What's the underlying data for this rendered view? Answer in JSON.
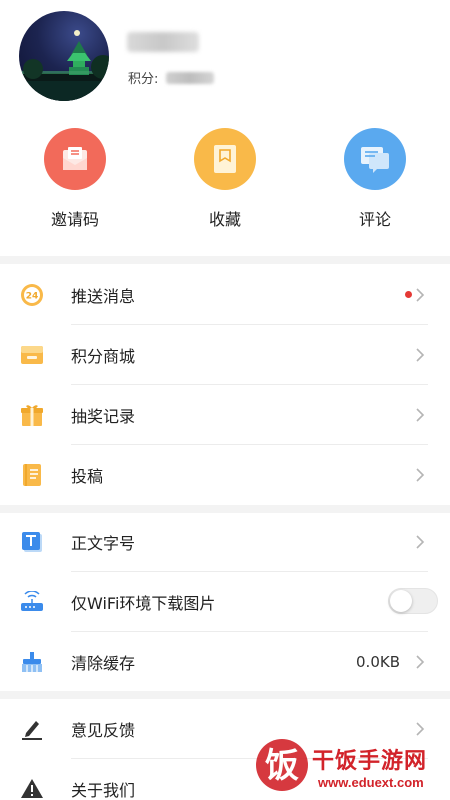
{
  "profile": {
    "points_label": "积分:"
  },
  "quick_actions": [
    {
      "label": "邀请码",
      "icon": "envelope-icon",
      "color": "#f26a5a"
    },
    {
      "label": "收藏",
      "icon": "bookmark-icon",
      "color": "#f9b949"
    },
    {
      "label": "评论",
      "icon": "comment-icon",
      "color": "#5aa9ef"
    }
  ],
  "menu_group1": [
    {
      "label": "推送消息",
      "icon": "push-24-icon",
      "has_dot": true
    },
    {
      "label": "积分商城",
      "icon": "shop-box-icon"
    },
    {
      "label": "抽奖记录",
      "icon": "gift-icon"
    },
    {
      "label": "投稿",
      "icon": "document-icon"
    }
  ],
  "menu_group2": [
    {
      "label": "正文字号",
      "icon": "font-size-icon"
    },
    {
      "label": "仅WiFi环境下载图片",
      "icon": "router-icon",
      "toggle_on": false
    },
    {
      "label": "清除缓存",
      "icon": "broom-icon",
      "value": "0.0KB"
    }
  ],
  "menu_group3": [
    {
      "label": "意见反馈",
      "icon": "pencil-icon"
    },
    {
      "label": "关于我们",
      "icon": "warning-icon"
    }
  ],
  "push_badge_text": "24",
  "watermark": {
    "title": "干饭手游网",
    "url": "www.eduext.com"
  },
  "colors": {
    "accent_red": "#e53935",
    "watermark_red": "#d2232a"
  }
}
